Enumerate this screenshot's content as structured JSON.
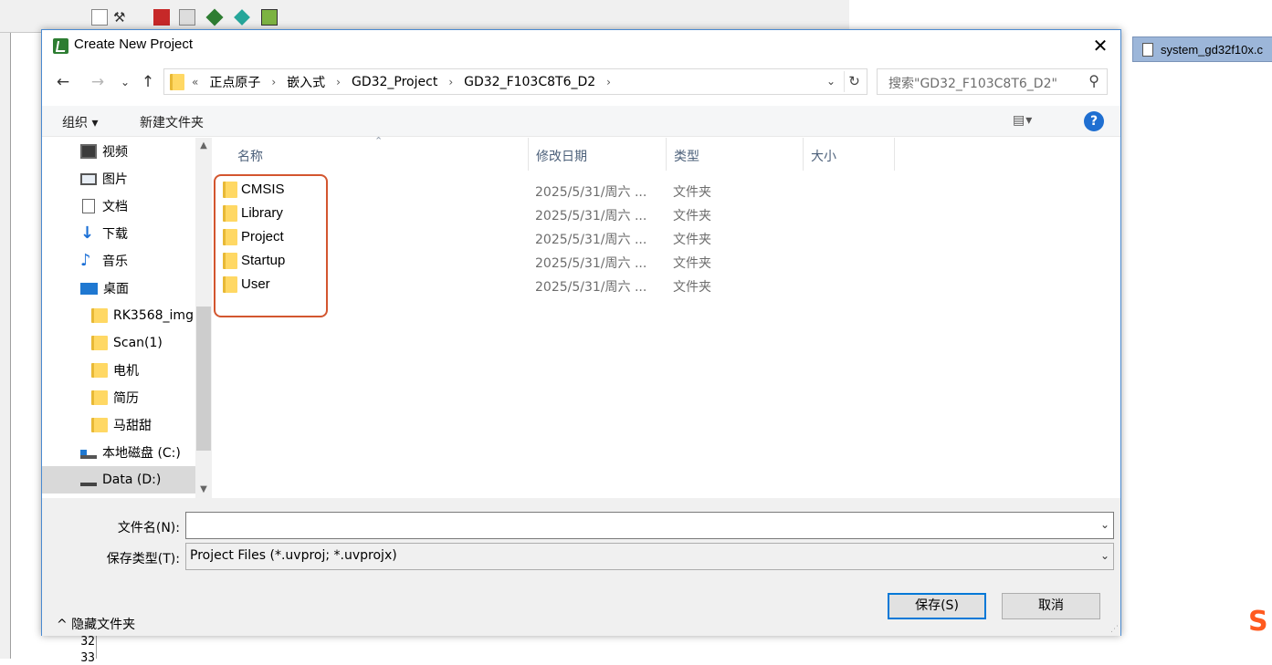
{
  "background_ide": {
    "tab_label": "system_gd32f10x.c",
    "line_number": "32",
    "line_number_next": "33"
  },
  "dialog": {
    "title": "Create New Project",
    "close_glyph": "✕",
    "nav": {
      "back": "←",
      "forward": "→",
      "recent": "⌄",
      "up": "↑"
    },
    "breadcrumb": {
      "overflow": "«",
      "items": [
        "正点原子",
        "嵌入式",
        "GD32_Project",
        "GD32_F103C8T6_D2"
      ]
    },
    "search_placeholder": "搜索\"GD32_F103C8T6_D2\"",
    "toolbar": {
      "organize": "组织 ▾",
      "new_folder": "新建文件夹",
      "view_glyph": "▤▾",
      "help_glyph": "?"
    },
    "nav_pane": {
      "items": [
        {
          "label": "视频",
          "icon": "video-icon"
        },
        {
          "label": "图片",
          "icon": "pictures-icon"
        },
        {
          "label": "文档",
          "icon": "documents-icon"
        },
        {
          "label": "下载",
          "icon": "downloads-icon"
        },
        {
          "label": "音乐",
          "icon": "music-icon"
        },
        {
          "label": "桌面",
          "icon": "desktop-icon"
        },
        {
          "label": "RK3568_img",
          "icon": "folder-icon"
        },
        {
          "label": "Scan(1)",
          "icon": "folder-icon"
        },
        {
          "label": "电机",
          "icon": "folder-icon"
        },
        {
          "label": "简历",
          "icon": "folder-icon"
        },
        {
          "label": "马甜甜",
          "icon": "folder-icon"
        },
        {
          "label": "本地磁盘 (C:)",
          "icon": "drive-c-icon"
        },
        {
          "label": "Data (D:)",
          "icon": "drive-d-icon",
          "selected": true
        }
      ]
    },
    "columns": {
      "name": "名称",
      "date": "修改日期",
      "type": "类型",
      "size": "大小"
    },
    "files": [
      {
        "name": "CMSIS",
        "date": "2025/5/31/周六 ...",
        "type": "文件夹"
      },
      {
        "name": "Library",
        "date": "2025/5/31/周六 ...",
        "type": "文件夹"
      },
      {
        "name": "Project",
        "date": "2025/5/31/周六 ...",
        "type": "文件夹"
      },
      {
        "name": "Startup",
        "date": "2025/5/31/周六 ...",
        "type": "文件夹"
      },
      {
        "name": "User",
        "date": "2025/5/31/周六 ...",
        "type": "文件夹"
      }
    ],
    "form": {
      "filename_label": "文件名(N):",
      "filename_value": "",
      "filetype_label": "保存类型(T):",
      "filetype_value": "Project Files (*.uvproj; *.uvprojx)",
      "hide_folders": "^  隐藏文件夹",
      "save": "保存(S)",
      "cancel": "取消"
    },
    "colors": {
      "accent": "#0078d7",
      "highlight": "#d3562f",
      "folder": "#ffd864"
    }
  }
}
